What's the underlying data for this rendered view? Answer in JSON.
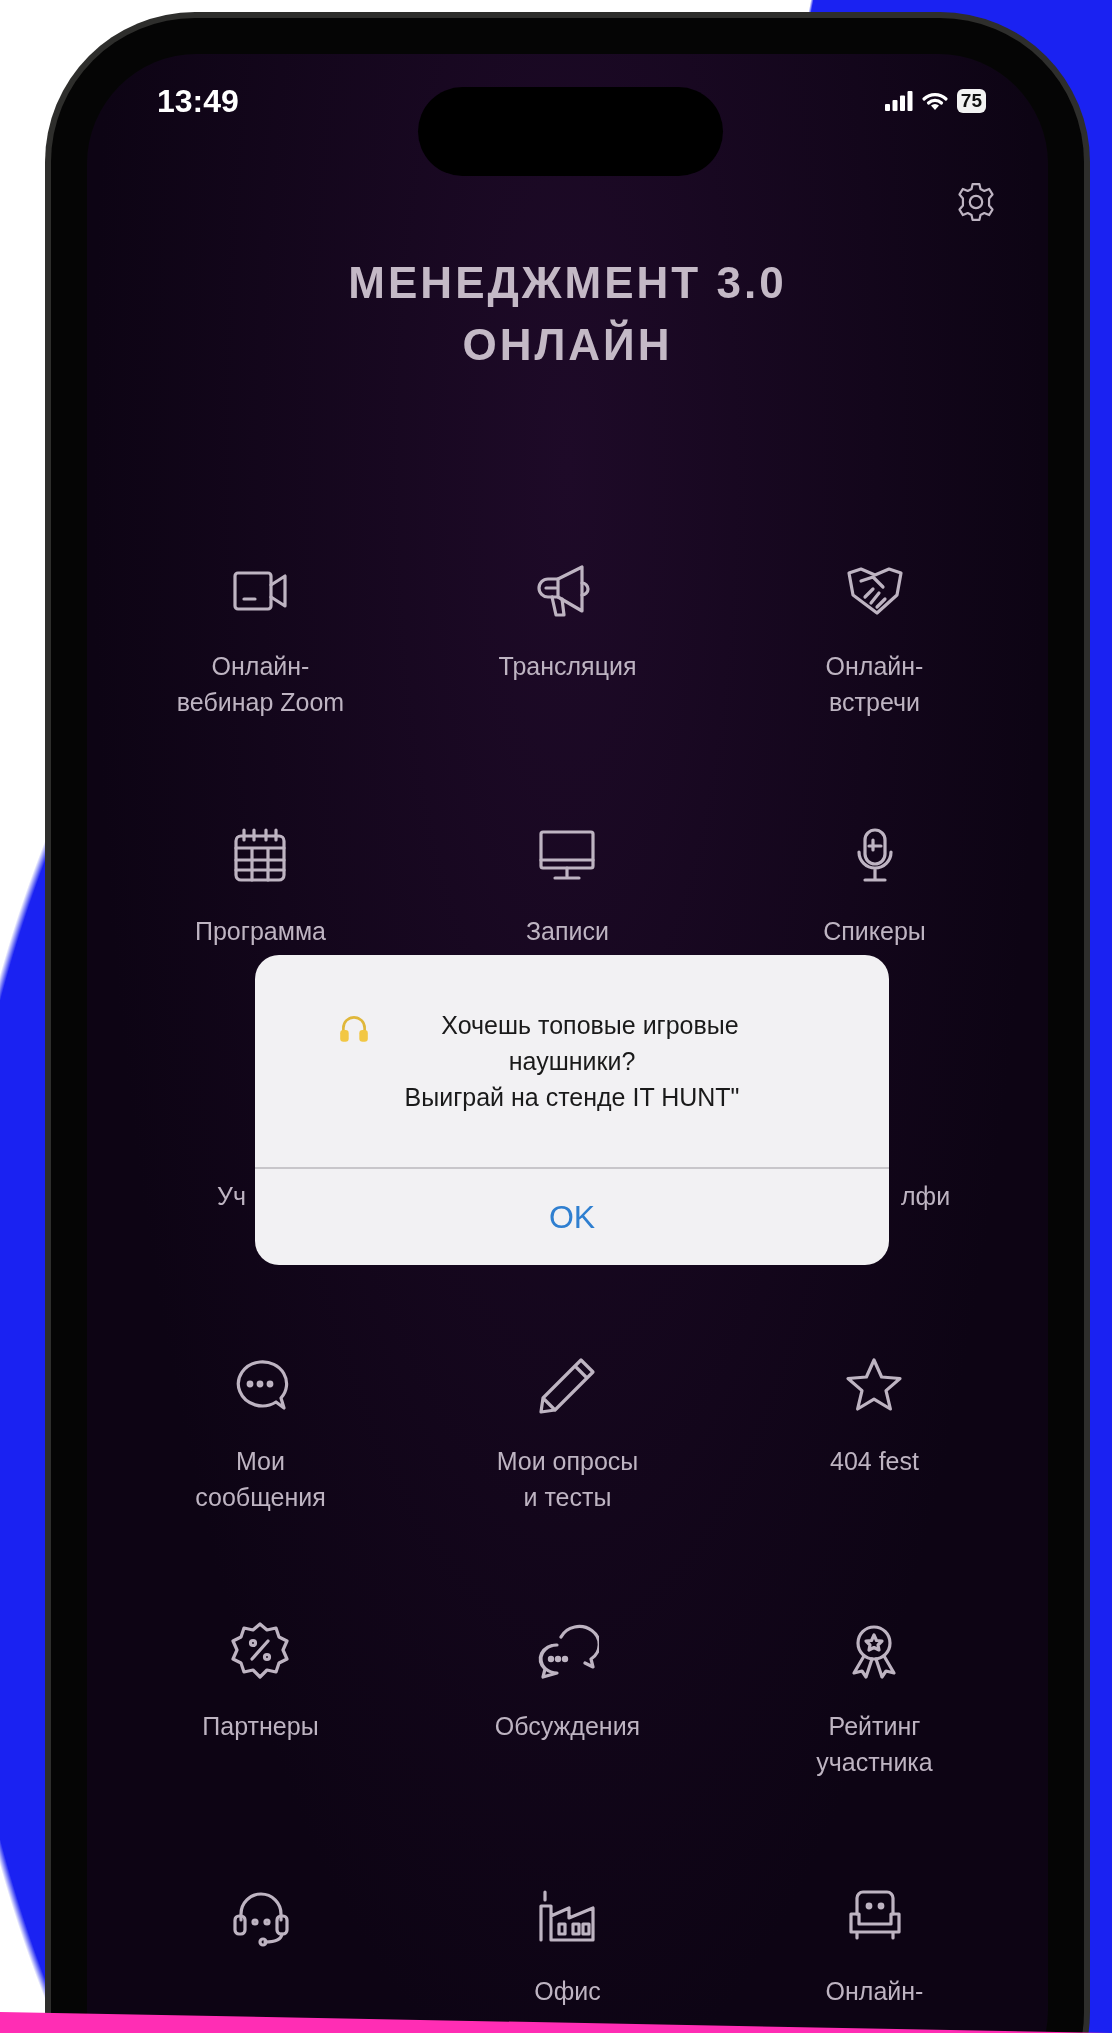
{
  "status_bar": {
    "time": "13:49",
    "battery": "75"
  },
  "header": {
    "title": "МЕНЕДЖМЕНТ 3.0\nОНЛАЙН"
  },
  "menu": {
    "rows": [
      {
        "cells": [
          {
            "kind": "tile",
            "label": "Онлайн-\nвебинар Zoom"
          },
          {
            "kind": "tile",
            "label": "Трансляция"
          },
          {
            "kind": "tile",
            "label": "Онлайн-\nвстречи"
          }
        ]
      },
      {
        "cells": [
          {
            "kind": "tile",
            "label": "Программа"
          },
          {
            "kind": "tile",
            "label": "Записи"
          },
          {
            "kind": "tile",
            "label": "Спикеры"
          }
        ]
      },
      {
        "cells": [
          {
            "kind": "covered-start",
            "label": "Уч"
          },
          "",
          {
            "kind": "covered-end",
            "label": "лфи"
          }
        ]
      },
      {
        "cells": [
          {
            "kind": "tile",
            "label": "Мои\nсообщения"
          },
          {
            "kind": "tile",
            "label": "Мои опросы\nи тесты"
          },
          {
            "kind": "tile",
            "label": "404 fest"
          }
        ]
      },
      {
        "cells": [
          {
            "kind": "tile",
            "label": "Партнеры"
          },
          {
            "kind": "tile",
            "label": "Обсуждения"
          },
          {
            "kind": "tile",
            "label": "Рейтинг\nучастника"
          }
        ]
      },
      {
        "cells": [
          {
            "kind": "icon"
          },
          {
            "kind": "tile",
            "label": "Офис"
          },
          {
            "kind": "tile",
            "label": "Онлайн-"
          }
        ]
      }
    ]
  },
  "alert": {
    "message": "Хочешь топовые игровые\nнаушники?\nВыиграй на стенде IT HUNT\"",
    "button": "OK"
  }
}
